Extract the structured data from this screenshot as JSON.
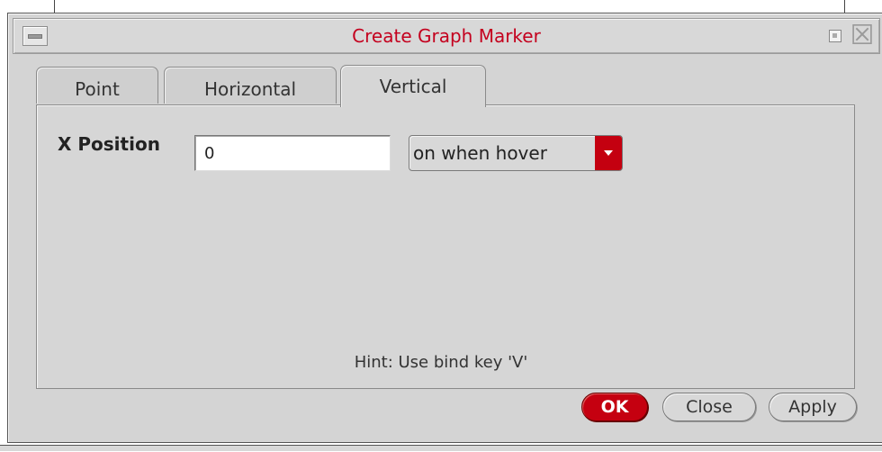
{
  "window": {
    "title": "Create Graph Marker",
    "menu_icon": "window-menu-icon",
    "minimize_icon": "minimize-icon",
    "close_icon": "close-icon",
    "close_glyph": "☒"
  },
  "tabs": [
    {
      "label": "Point",
      "active": false
    },
    {
      "label": "Horizontal",
      "active": false
    },
    {
      "label": "Vertical",
      "active": true
    }
  ],
  "form": {
    "x_position_label": "X Position",
    "x_position_value": "0",
    "display_mode": {
      "selected": "on when hover",
      "icon": "dropdown-arrow-icon"
    },
    "hint": "Hint: Use bind key 'V'"
  },
  "buttons": {
    "ok": "OK",
    "close": "Close",
    "apply": "Apply"
  },
  "colors": {
    "title": "#c4001e",
    "accent": "#c50010",
    "background": "#d4d4d4"
  }
}
